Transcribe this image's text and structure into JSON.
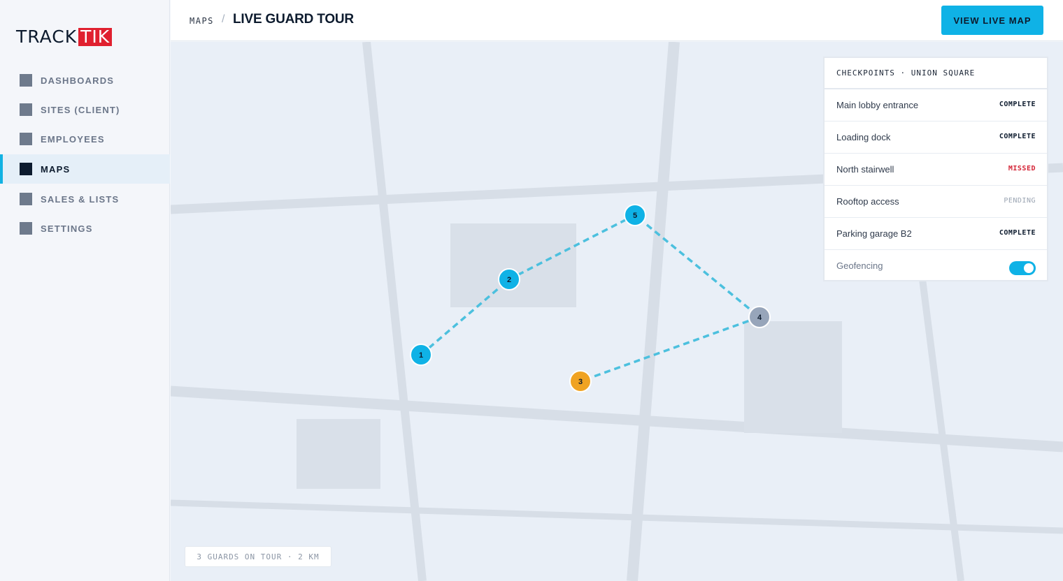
{
  "logo": {
    "part1": "TRACK",
    "part2": "TIK"
  },
  "sidebar": {
    "items": [
      {
        "label": "DASHBOARDS"
      },
      {
        "label": "SITES (CLIENT)"
      },
      {
        "label": "EMPLOYEES"
      },
      {
        "label": "MAPS"
      },
      {
        "label": "SALES & LISTS"
      },
      {
        "label": "SETTINGS"
      }
    ],
    "active": "MAPS"
  },
  "header": {
    "breadcrumb_root": "MAPS",
    "separator": "/",
    "title": "LIVE GUARD TOUR",
    "view_live_map_label": "VIEW LIVE MAP"
  },
  "map": {
    "markers": [
      {
        "label": "1",
        "color": "#0fb2e6"
      },
      {
        "label": "2",
        "color": "#0fb2e6"
      },
      {
        "label": "5",
        "color": "#0fb2e6"
      },
      {
        "label": "4",
        "color": "#97a5ba"
      },
      {
        "label": "3",
        "color": "#f0a322"
      }
    ],
    "route_color": "#4cc0de",
    "summary": "3 GUARDS ON TOUR · 2 KM"
  },
  "checkpoints": {
    "heading": "CHECKPOINTS · UNION SQUARE",
    "rows": [
      {
        "name": "Main lobby entrance",
        "status": "COMPLETE"
      },
      {
        "name": "Loading dock",
        "status": "COMPLETE"
      },
      {
        "name": "North stairwell",
        "status": "MISSED"
      },
      {
        "name": "Rooftop access",
        "status": "PENDING"
      },
      {
        "name": "Parking garage B2",
        "status": "COMPLETE"
      }
    ],
    "geofencing_label": "Geofencing",
    "geofencing_on": true
  },
  "colors": {
    "accent": "#0fb2e6",
    "brand_red": "#e0202f",
    "missed": "#d42436",
    "pending_marker": "#f0a322"
  }
}
